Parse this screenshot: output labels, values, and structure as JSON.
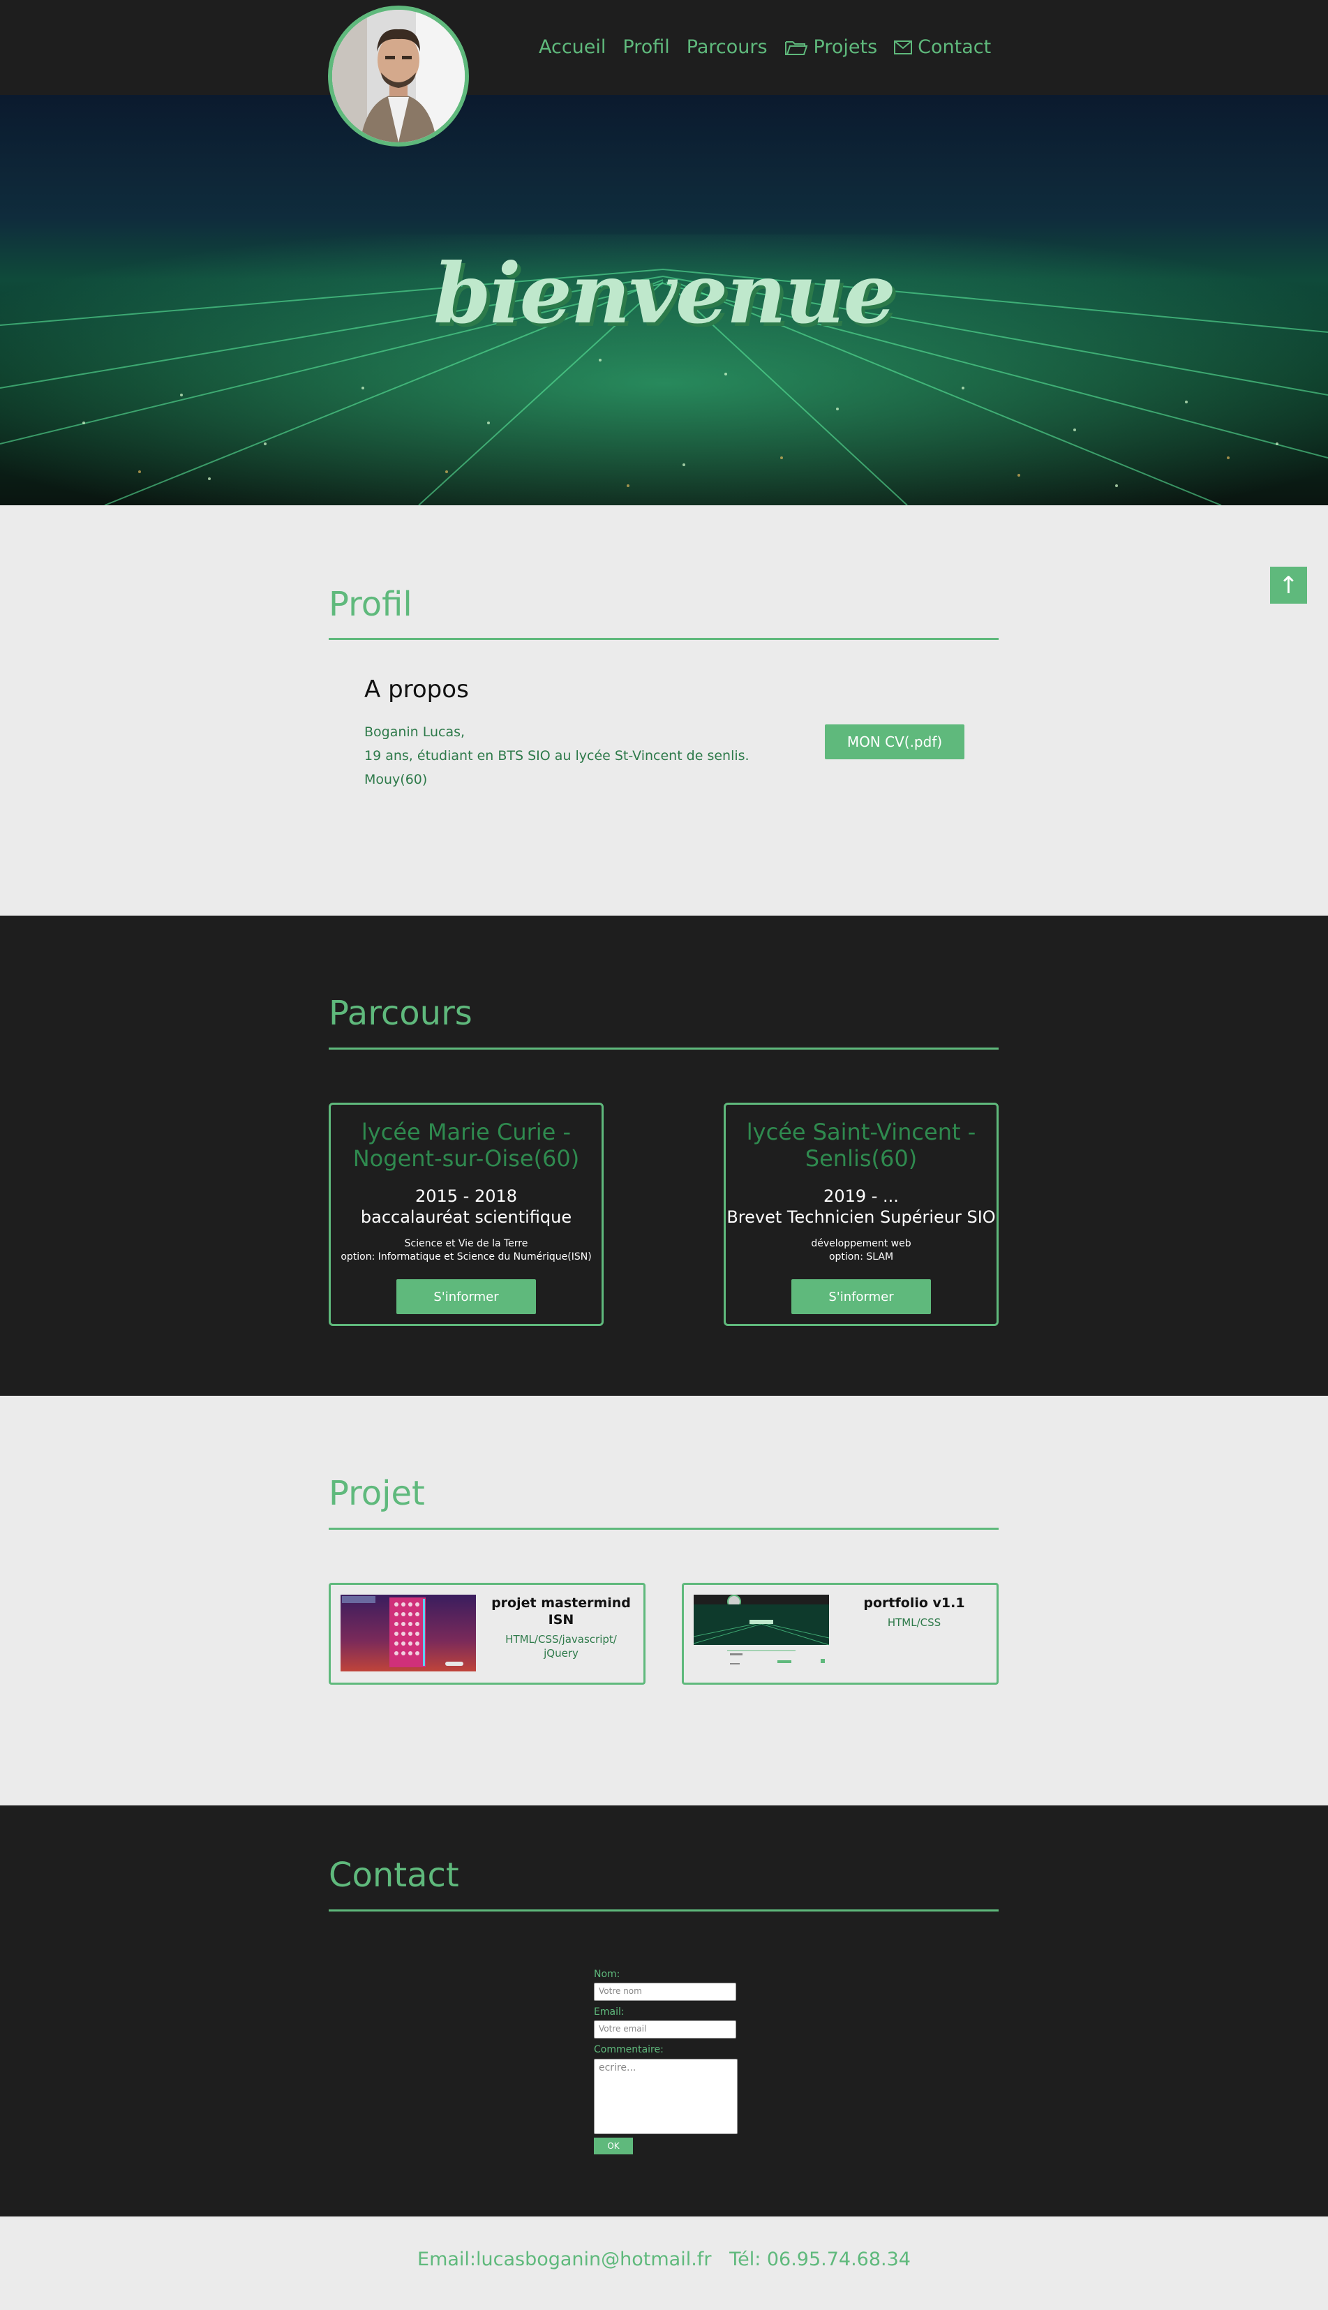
{
  "nav": {
    "items": [
      {
        "label": "Accueil",
        "icon": ""
      },
      {
        "label": "Profil",
        "icon": ""
      },
      {
        "label": "Parcours",
        "icon": ""
      },
      {
        "label": "Projets",
        "icon": "folder-icon"
      },
      {
        "label": "Contact",
        "icon": "mail-icon"
      }
    ]
  },
  "hero": {
    "title": "bienvenue"
  },
  "profil": {
    "title": "Profil",
    "about_title": "A propos",
    "lines": [
      "Boganin Lucas,",
      "19 ans, étudiant en BTS SIO au lycée St-Vincent de senlis.",
      "Mouy(60)"
    ],
    "cv_button": "MON CV(.pdf)"
  },
  "top_button": {
    "label": "↑"
  },
  "parcours": {
    "title": "Parcours",
    "cards": [
      {
        "school": "lycée Marie Curie - Nogent-sur-Oise(60)",
        "years": "2015 - 2018",
        "degree": "baccalauréat scientifique",
        "detail1": "Science et Vie de la Terre",
        "detail2": "option: Informatique et Science du Numérique(ISN)",
        "button": "S'informer"
      },
      {
        "school": "lycée Saint-Vincent - Senlis(60)",
        "years": "2019 - ...",
        "degree": "Brevet Technicien Supérieur SIO",
        "detail1": "développement web",
        "detail2": "option: SLAM",
        "button": "S'informer"
      }
    ]
  },
  "projet": {
    "title": "Projet",
    "items": [
      {
        "title": "projet mastermind ISN",
        "tech": "HTML/CSS/javascript/ jQuery"
      },
      {
        "title": "portfolio v1.1",
        "tech": "HTML/CSS"
      }
    ]
  },
  "contact": {
    "title": "Contact",
    "name_label": "Nom:",
    "name_placeholder": "Votre nom",
    "email_label": "Email:",
    "email_placeholder": "Votre email",
    "comment_label": "Commentaire:",
    "comment_placeholder": "ecrire...",
    "submit": "OK"
  },
  "footer": {
    "email": "Email:lucasboganin@hotmail.fr",
    "phone": "Tél: 06.95.74.68.34"
  },
  "colors": {
    "accent": "#5fb97c",
    "dark": "#1e1e1e",
    "light": "#ebebeb"
  }
}
